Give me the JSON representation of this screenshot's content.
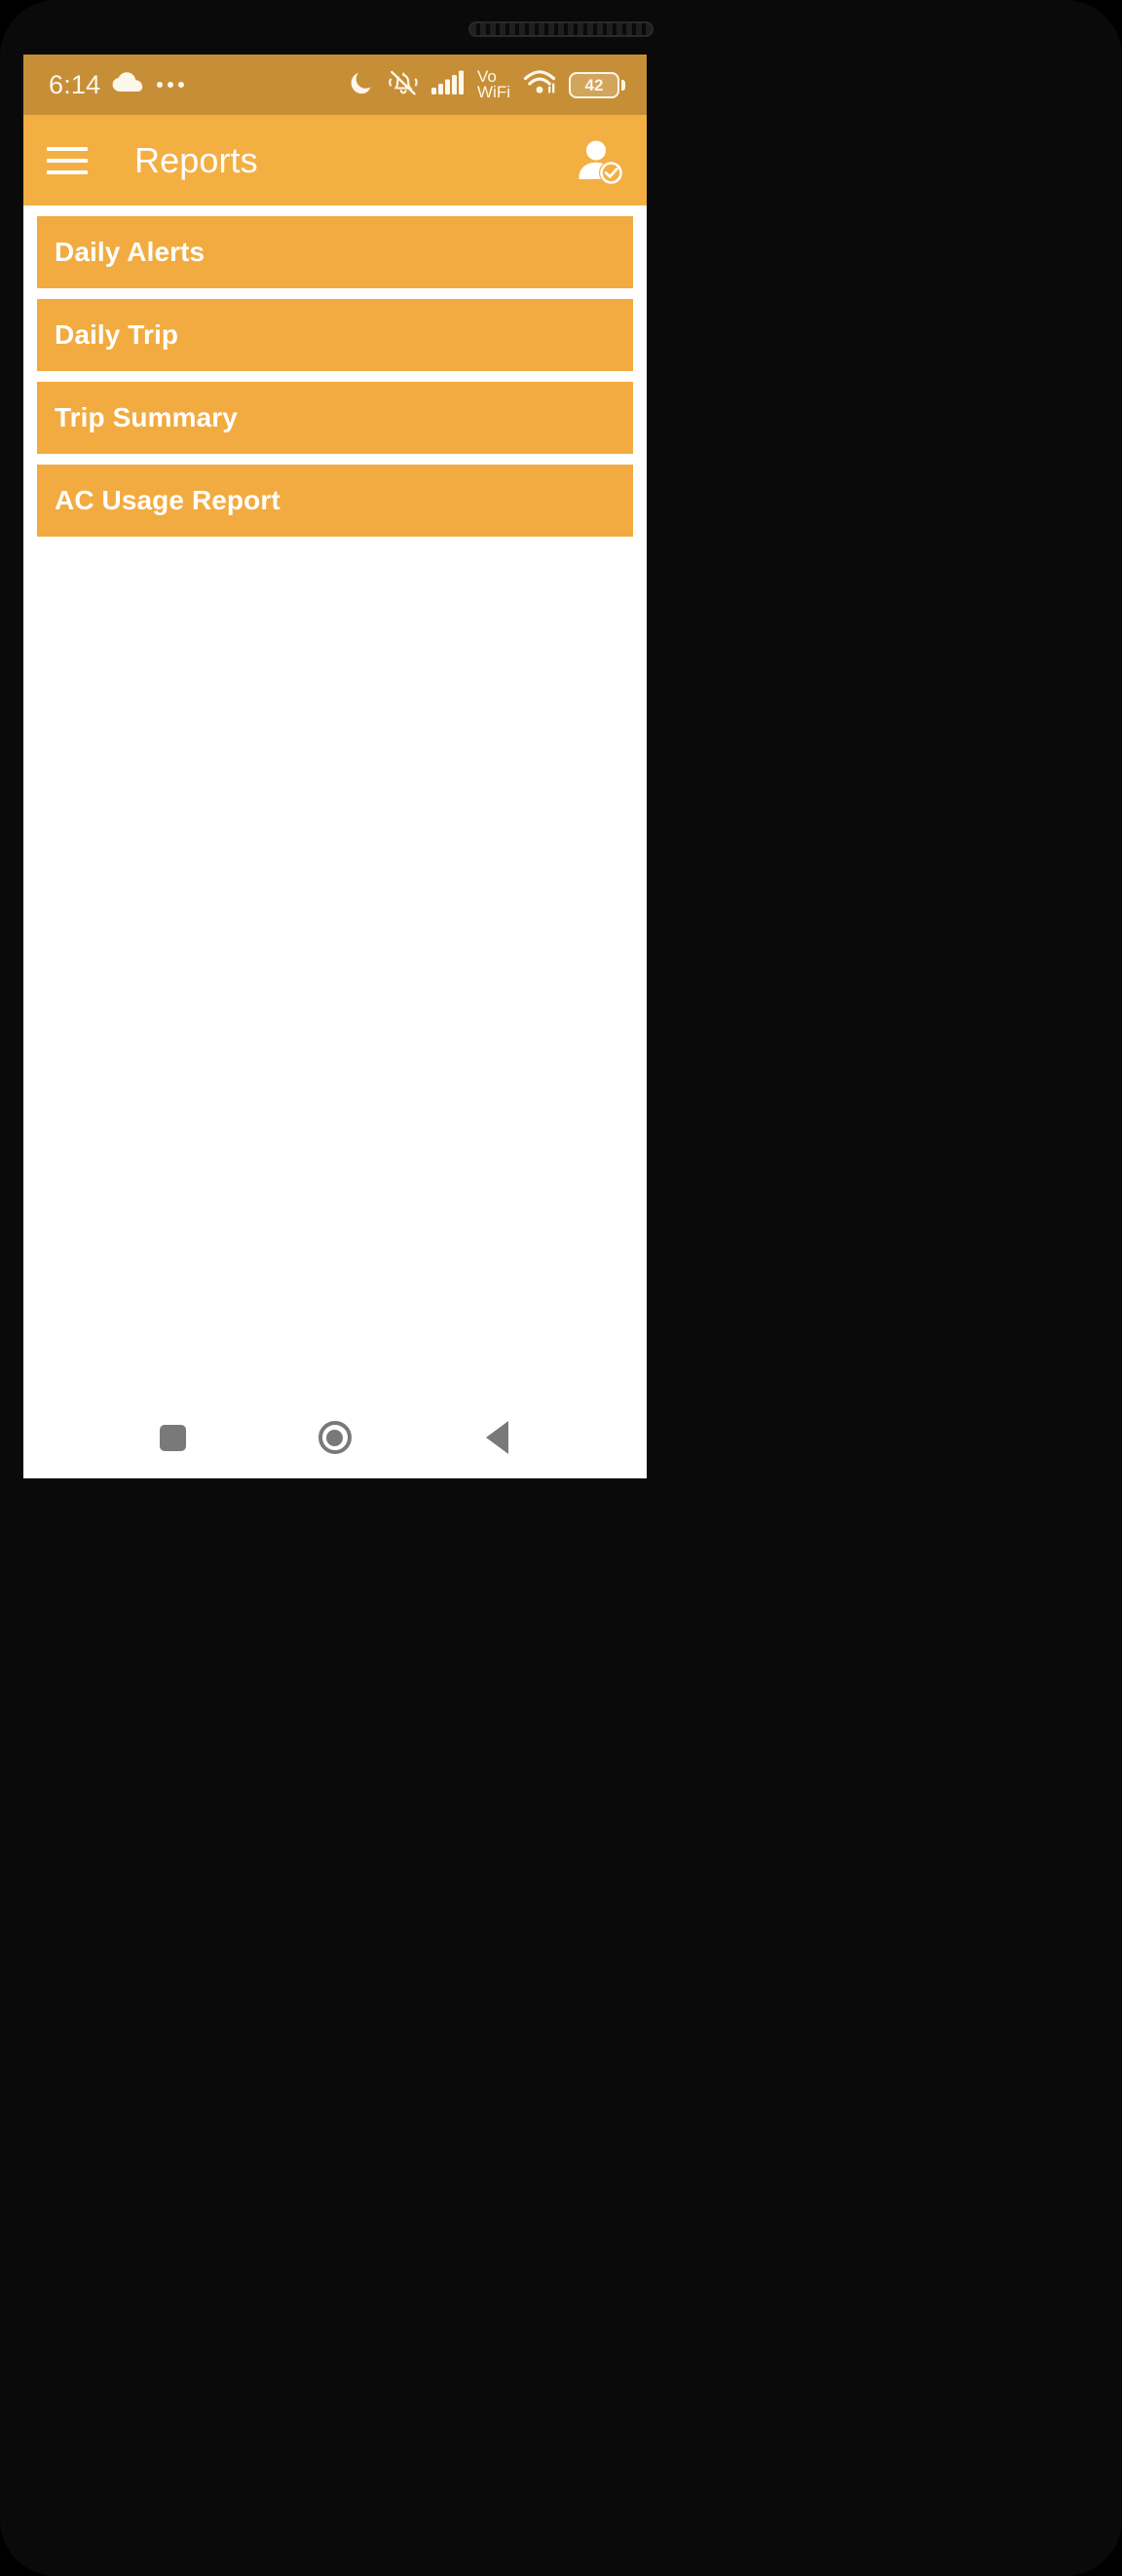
{
  "device": {
    "earpiece_label": "earpiece-speaker"
  },
  "status_bar": {
    "time": "6:14",
    "background_color": "#c68f37",
    "icons": {
      "weather": "cloud-icon",
      "overflow": "more-notifications-icon",
      "dnd": "moon-icon",
      "ringer": "bell-muted-vibrate-icon",
      "signal": "cellular-signal-icon",
      "wifi": "wifi-icon"
    },
    "vowifi": {
      "line1": "Vo",
      "line2": "WiFi"
    },
    "battery": {
      "level": "42",
      "icon": "battery-icon"
    }
  },
  "app_bar": {
    "menu_icon": "hamburger-menu-icon",
    "title": "Reports",
    "profile_icon": "user-verified-icon",
    "background_color": "#f4af43"
  },
  "reports": {
    "item_color": "#f2ab40",
    "items": [
      {
        "label": "Daily Alerts"
      },
      {
        "label": "Daily Trip"
      },
      {
        "label": "Trip Summary"
      },
      {
        "label": "AC Usage Report"
      }
    ]
  },
  "nav_bar": {
    "recents": "recents-square-icon",
    "home": "home-circle-icon",
    "back": "back-triangle-icon"
  }
}
